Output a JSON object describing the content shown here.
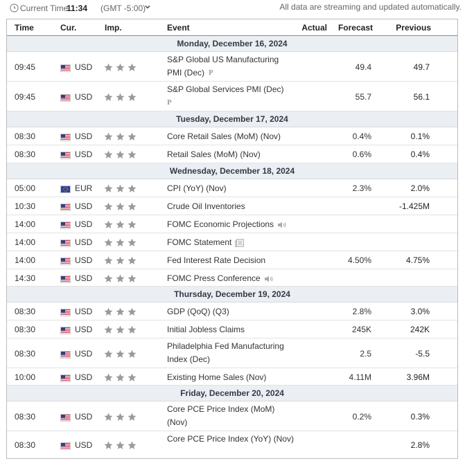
{
  "topbar": {
    "current_time_label": "Current Time:",
    "current_time": "11:34",
    "gmt": "(GMT -5:00)",
    "streaming_note": "All data are streaming and updated automatically."
  },
  "headers": {
    "time": "Time",
    "currency": "Cur.",
    "importance": "Imp.",
    "event": "Event",
    "actual": "Actual",
    "forecast": "Forecast",
    "previous": "Previous"
  },
  "days": [
    "Monday, December 16, 2024",
    "Tuesday, December 17, 2024",
    "Wednesday, December 18, 2024",
    "Thursday, December 19, 2024",
    "Friday, December 20, 2024"
  ],
  "rows": [
    {
      "time": "09:45",
      "currency": "USD",
      "flag": "us-flag",
      "importance": 3,
      "event": "S&P Global US Manufacturing PMI (Dec)",
      "icon": "preliminary-icon",
      "icon_text": "P",
      "actual": "",
      "forecast": "49.4",
      "previous": "49.7"
    },
    {
      "time": "09:45",
      "currency": "USD",
      "flag": "us-flag",
      "importance": 3,
      "event": "S&P Global Services PMI (Dec)",
      "icon": "preliminary-icon",
      "icon_text": "P",
      "actual": "",
      "forecast": "55.7",
      "previous": "56.1"
    },
    {
      "time": "08:30",
      "currency": "USD",
      "flag": "us-flag",
      "importance": 3,
      "event": "Core Retail Sales (MoM) (Nov)",
      "actual": "",
      "forecast": "0.4%",
      "previous": "0.1%"
    },
    {
      "time": "08:30",
      "currency": "USD",
      "flag": "us-flag",
      "importance": 3,
      "event": "Retail Sales (MoM) (Nov)",
      "actual": "",
      "forecast": "0.6%",
      "previous": "0.4%"
    },
    {
      "time": "05:00",
      "currency": "EUR",
      "flag": "eu-flag",
      "importance": 3,
      "event": "CPI (YoY) (Nov)",
      "actual": "",
      "forecast": "2.3%",
      "previous": "2.0%"
    },
    {
      "time": "10:30",
      "currency": "USD",
      "flag": "us-flag",
      "importance": 3,
      "event": "Crude Oil Inventories",
      "actual": "",
      "forecast": "",
      "previous": "-1.425M"
    },
    {
      "time": "14:00",
      "currency": "USD",
      "flag": "us-flag",
      "importance": 3,
      "event": "FOMC Economic Projections",
      "icon": "speaker-icon",
      "actual": "",
      "forecast": "",
      "previous": ""
    },
    {
      "time": "14:00",
      "currency": "USD",
      "flag": "us-flag",
      "importance": 3,
      "event": "FOMC Statement",
      "icon": "document-icon",
      "actual": "",
      "forecast": "",
      "previous": ""
    },
    {
      "time": "14:00",
      "currency": "USD",
      "flag": "us-flag",
      "importance": 3,
      "event": "Fed Interest Rate Decision",
      "actual": "",
      "forecast": "4.50%",
      "previous": "4.75%"
    },
    {
      "time": "14:30",
      "currency": "USD",
      "flag": "us-flag",
      "importance": 3,
      "event": "FOMC Press Conference",
      "icon": "speaker-icon",
      "actual": "",
      "forecast": "",
      "previous": ""
    },
    {
      "time": "08:30",
      "currency": "USD",
      "flag": "us-flag",
      "importance": 3,
      "event": "GDP (QoQ) (Q3)",
      "actual": "",
      "forecast": "2.8%",
      "previous": "3.0%"
    },
    {
      "time": "08:30",
      "currency": "USD",
      "flag": "us-flag",
      "importance": 3,
      "event": "Initial Jobless Claims",
      "actual": "",
      "forecast": "245K",
      "previous": "242K"
    },
    {
      "time": "08:30",
      "currency": "USD",
      "flag": "us-flag",
      "importance": 3,
      "event": "Philadelphia Fed Manufacturing Index (Dec)",
      "actual": "",
      "forecast": "2.5",
      "previous": "-5.5"
    },
    {
      "time": "10:00",
      "currency": "USD",
      "flag": "us-flag",
      "importance": 3,
      "event": "Existing Home Sales (Nov)",
      "actual": "",
      "forecast": "4.11M",
      "previous": "3.96M"
    },
    {
      "time": "08:30",
      "currency": "USD",
      "flag": "us-flag",
      "importance": 3,
      "event": "Core PCE Price Index (MoM) (Nov)",
      "actual": "",
      "forecast": "0.2%",
      "previous": "0.3%"
    },
    {
      "time": "08:30",
      "currency": "USD",
      "flag": "us-flag",
      "importance": 3,
      "event": "Core PCE Price Index (YoY) (Nov)",
      "actual": "",
      "forecast": "",
      "previous": "2.8%"
    }
  ],
  "colors": {
    "day_bg": "#ebeef2",
    "star": "#9a9a9a",
    "header_border": "#888888"
  }
}
